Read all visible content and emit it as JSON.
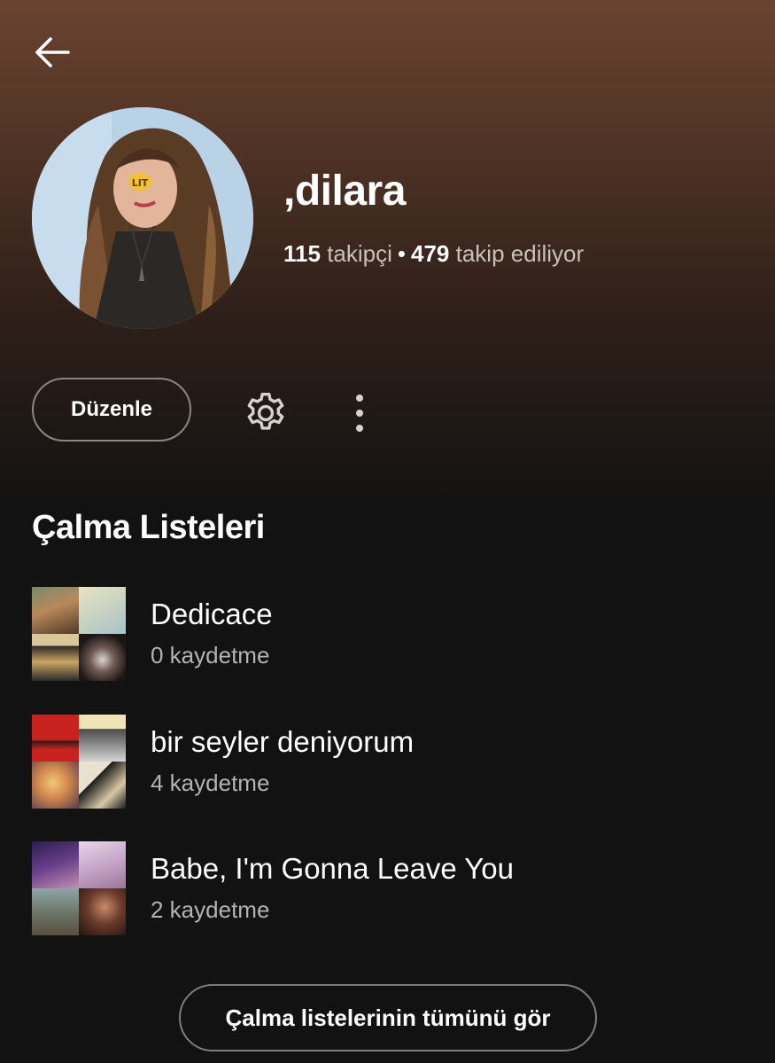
{
  "profile": {
    "name": ",dilara",
    "followers_count": "115",
    "followers_label": "takipçi",
    "separator": "•",
    "following_count": "479",
    "following_label": "takip ediliyor"
  },
  "actions": {
    "edit_label": "Düzenle",
    "settings_icon": "gear-icon",
    "more_icon": "more-vertical-icon",
    "back_icon": "back-arrow-icon"
  },
  "playlists_section": {
    "title": "Çalma Listeleri",
    "items": [
      {
        "name": "Dedicace",
        "saves": "0 kaydetme"
      },
      {
        "name": "bir seyler deniyorum",
        "saves": "4 kaydetme"
      },
      {
        "name": "Babe, I'm Gonna Leave You",
        "saves": "2 kaydetme"
      }
    ],
    "see_all_label": "Çalma listelerinin tümünü gör"
  },
  "colors": {
    "header_gradient_top": "#6a4330",
    "background": "#121212",
    "text_primary": "#ffffff",
    "text_secondary": "#b3b3b3"
  }
}
